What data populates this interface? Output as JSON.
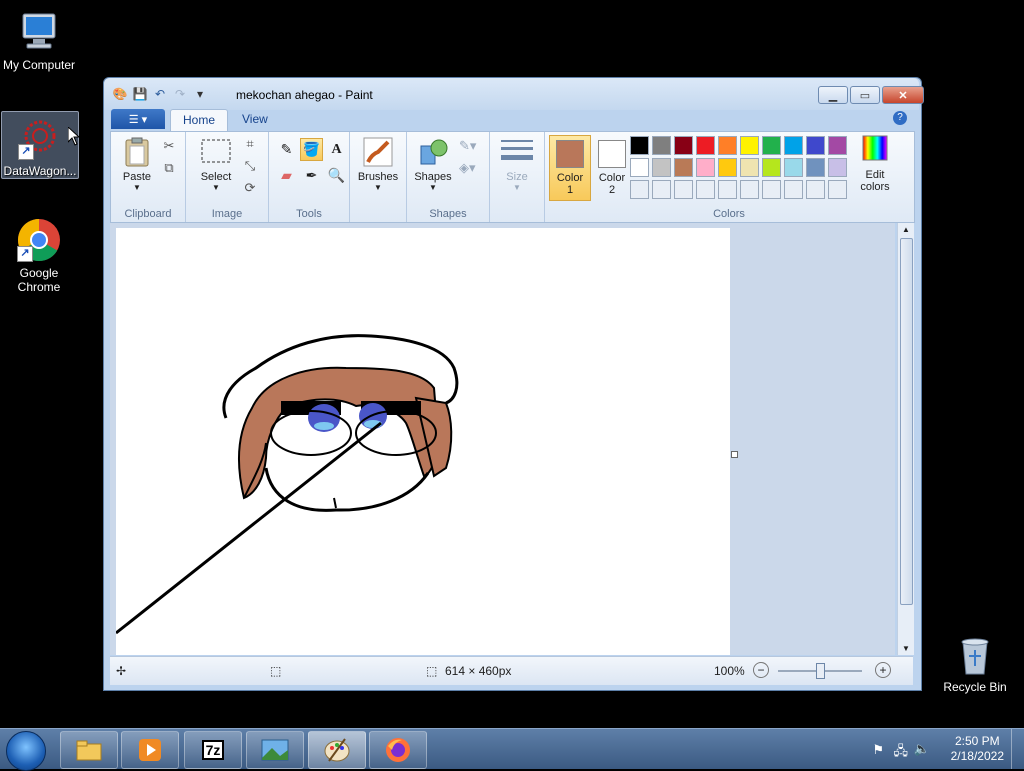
{
  "desktop": {
    "icons": [
      {
        "label": "My Computer"
      },
      {
        "label": "DataWagon..."
      },
      {
        "label": "Google Chrome"
      },
      {
        "label": "Recycle Bin"
      }
    ]
  },
  "window": {
    "title": "mekochan ahegao - Paint",
    "tabs": [
      {
        "label": "Home"
      },
      {
        "label": "View"
      }
    ],
    "help_label": "?"
  },
  "ribbon": {
    "clipboard": {
      "paste_label": "Paste",
      "group_label": "Clipboard"
    },
    "image": {
      "select_label": "Select",
      "group_label": "Image"
    },
    "tools": {
      "group_label": "Tools"
    },
    "brushes": {
      "label": "Brushes"
    },
    "shapes": {
      "label": "Shapes",
      "group_label": "Shapes"
    },
    "size": {
      "label": "Size"
    },
    "colors": {
      "color1_label": "Color",
      "color1_num": "1",
      "color2_label": "Color",
      "color2_num": "2",
      "edit_label": "Edit",
      "edit_label2": "colors",
      "group_label": "Colors",
      "color1": "#b9775a",
      "color2": "#ffffff",
      "palette_row1": [
        "#000000",
        "#7f7f7f",
        "#880015",
        "#ed1c24",
        "#ff7f27",
        "#fff200",
        "#22b14c",
        "#00a2e8",
        "#3f48cc",
        "#a349a4"
      ],
      "palette_row2": [
        "#ffffff",
        "#c3c3c3",
        "#b97a57",
        "#ffaec9",
        "#ffc90e",
        "#efe4b0",
        "#b5e61d",
        "#99d9ea",
        "#7092be",
        "#c8bfe7"
      ]
    }
  },
  "status": {
    "dimensions": "614 × 460px",
    "zoom": "100%"
  },
  "taskbar": {
    "clock_time": "2:50 PM",
    "clock_date": "2/18/2022",
    "apps": [
      {
        "name": "explorer-icon"
      },
      {
        "name": "media-player-icon"
      },
      {
        "name": "7zip-icon",
        "label": "7z"
      },
      {
        "name": "photo-viewer-icon"
      },
      {
        "name": "paint-icon"
      },
      {
        "name": "firefox-icon"
      }
    ]
  }
}
